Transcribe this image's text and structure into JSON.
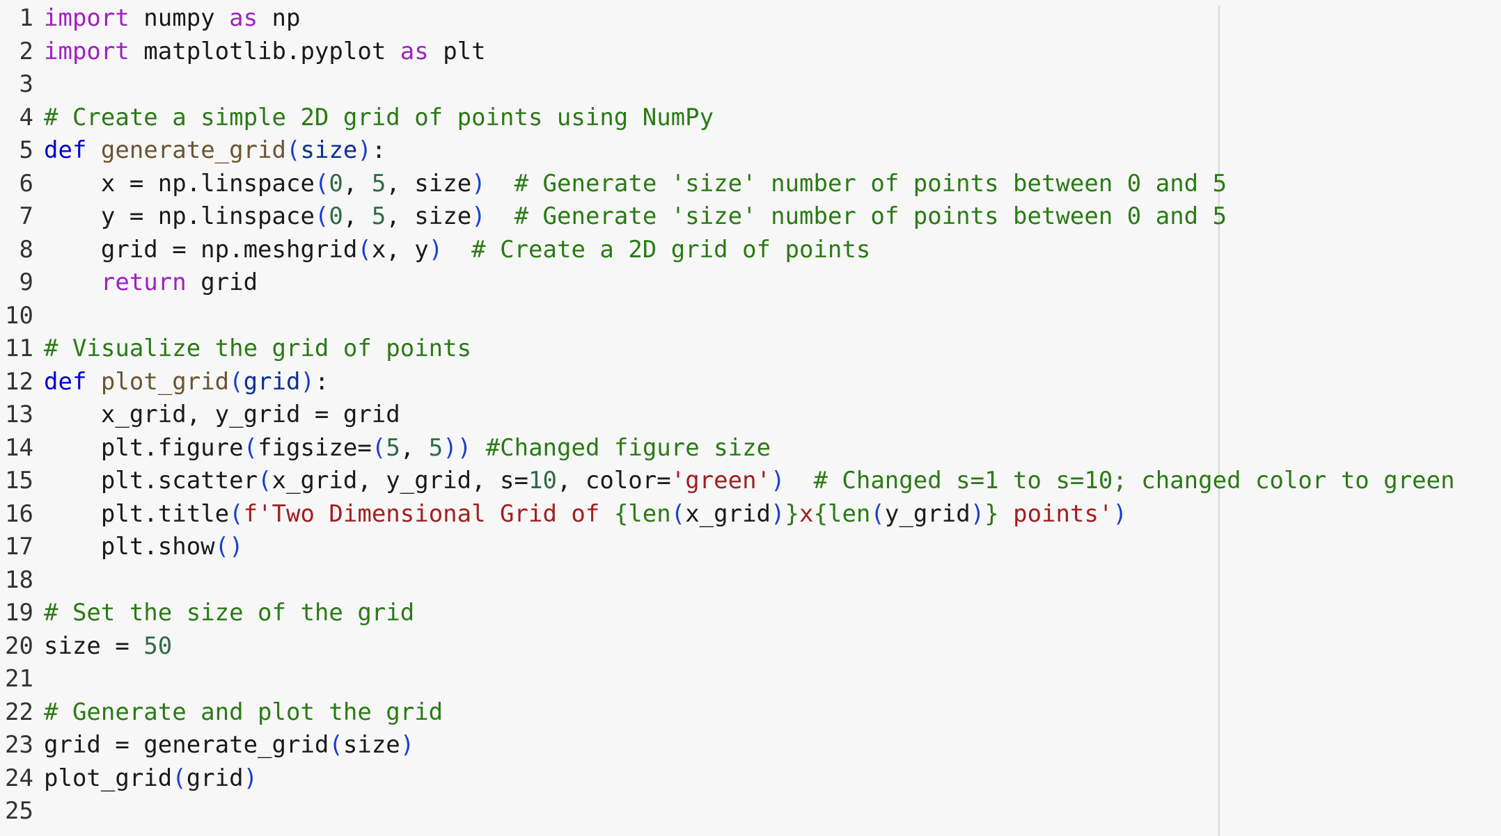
{
  "editor": {
    "lines": [
      {
        "number": "1",
        "tokens": [
          {
            "t": "import",
            "c": "kw"
          },
          {
            "t": " numpy ",
            "c": ""
          },
          {
            "t": "as",
            "c": "kw"
          },
          {
            "t": " np",
            "c": ""
          }
        ]
      },
      {
        "number": "2",
        "tokens": [
          {
            "t": "import",
            "c": "kw"
          },
          {
            "t": " matplotlib.pyplot ",
            "c": ""
          },
          {
            "t": "as",
            "c": "kw"
          },
          {
            "t": " plt",
            "c": ""
          }
        ]
      },
      {
        "number": "3",
        "tokens": []
      },
      {
        "number": "4",
        "tokens": [
          {
            "t": "# Create a simple 2D grid of points using NumPy",
            "c": "cm"
          }
        ]
      },
      {
        "number": "5",
        "tokens": [
          {
            "t": "def",
            "c": "def"
          },
          {
            "t": " ",
            "c": ""
          },
          {
            "t": "generate_grid",
            "c": "fn"
          },
          {
            "t": "(",
            "c": "paren"
          },
          {
            "t": "size",
            "c": "param"
          },
          {
            "t": ")",
            "c": "paren"
          },
          {
            "t": ":",
            "c": ""
          }
        ]
      },
      {
        "number": "6",
        "tokens": [
          {
            "t": "    x = np.linspace",
            "c": ""
          },
          {
            "t": "(",
            "c": "paren"
          },
          {
            "t": "0",
            "c": "num"
          },
          {
            "t": ", ",
            "c": ""
          },
          {
            "t": "5",
            "c": "num"
          },
          {
            "t": ", size",
            "c": ""
          },
          {
            "t": ")",
            "c": "paren"
          },
          {
            "t": "  ",
            "c": ""
          },
          {
            "t": "# Generate 'size' number of points between 0 and 5",
            "c": "cm"
          }
        ]
      },
      {
        "number": "7",
        "tokens": [
          {
            "t": "    y = np.linspace",
            "c": ""
          },
          {
            "t": "(",
            "c": "paren"
          },
          {
            "t": "0",
            "c": "num"
          },
          {
            "t": ", ",
            "c": ""
          },
          {
            "t": "5",
            "c": "num"
          },
          {
            "t": ", size",
            "c": ""
          },
          {
            "t": ")",
            "c": "paren"
          },
          {
            "t": "  ",
            "c": ""
          },
          {
            "t": "# Generate 'size' number of points between 0 and 5",
            "c": "cm"
          }
        ]
      },
      {
        "number": "8",
        "tokens": [
          {
            "t": "    grid = np.meshgrid",
            "c": ""
          },
          {
            "t": "(",
            "c": "paren"
          },
          {
            "t": "x, y",
            "c": ""
          },
          {
            "t": ")",
            "c": "paren"
          },
          {
            "t": "  ",
            "c": ""
          },
          {
            "t": "# Create a 2D grid of points",
            "c": "cm"
          }
        ]
      },
      {
        "number": "9",
        "tokens": [
          {
            "t": "    ",
            "c": ""
          },
          {
            "t": "return",
            "c": "kw"
          },
          {
            "t": " grid",
            "c": ""
          }
        ]
      },
      {
        "number": "10",
        "tokens": []
      },
      {
        "number": "11",
        "tokens": [
          {
            "t": "# Visualize the grid of points",
            "c": "cm"
          }
        ]
      },
      {
        "number": "12",
        "tokens": [
          {
            "t": "def",
            "c": "def"
          },
          {
            "t": " ",
            "c": ""
          },
          {
            "t": "plot_grid",
            "c": "fn"
          },
          {
            "t": "(",
            "c": "paren"
          },
          {
            "t": "grid",
            "c": "param"
          },
          {
            "t": ")",
            "c": "paren"
          },
          {
            "t": ":",
            "c": ""
          }
        ]
      },
      {
        "number": "13",
        "tokens": [
          {
            "t": "    x_grid, y_grid = grid",
            "c": ""
          }
        ]
      },
      {
        "number": "14",
        "tokens": [
          {
            "t": "    plt.figure",
            "c": ""
          },
          {
            "t": "(",
            "c": "paren"
          },
          {
            "t": "figsize=",
            "c": ""
          },
          {
            "t": "(",
            "c": "paren"
          },
          {
            "t": "5",
            "c": "num"
          },
          {
            "t": ", ",
            "c": ""
          },
          {
            "t": "5",
            "c": "num"
          },
          {
            "t": "))",
            "c": "paren"
          },
          {
            "t": " ",
            "c": ""
          },
          {
            "t": "#Changed figure size",
            "c": "cm"
          }
        ]
      },
      {
        "number": "15",
        "tokens": [
          {
            "t": "    plt.scatter",
            "c": ""
          },
          {
            "t": "(",
            "c": "paren"
          },
          {
            "t": "x_grid, y_grid, s=",
            "c": ""
          },
          {
            "t": "10",
            "c": "num"
          },
          {
            "t": ", color=",
            "c": ""
          },
          {
            "t": "'green'",
            "c": "str"
          },
          {
            "t": ")",
            "c": "paren"
          },
          {
            "t": "  ",
            "c": ""
          },
          {
            "t": "# Changed s=1 to s=10; changed color to green",
            "c": "cm"
          }
        ]
      },
      {
        "number": "16",
        "tokens": [
          {
            "t": "    plt.title",
            "c": ""
          },
          {
            "t": "(",
            "c": "paren"
          },
          {
            "t": "f'Two Dimensional Grid of ",
            "c": "str"
          },
          {
            "t": "{",
            "c": "brace"
          },
          {
            "t": "len",
            "c": "brace"
          },
          {
            "t": "(",
            "c": "paren"
          },
          {
            "t": "x_grid",
            "c": ""
          },
          {
            "t": ")",
            "c": "paren"
          },
          {
            "t": "}",
            "c": "brace"
          },
          {
            "t": "x",
            "c": "str"
          },
          {
            "t": "{",
            "c": "brace"
          },
          {
            "t": "len",
            "c": "brace"
          },
          {
            "t": "(",
            "c": "paren"
          },
          {
            "t": "y_grid",
            "c": ""
          },
          {
            "t": ")",
            "c": "paren"
          },
          {
            "t": "}",
            "c": "brace"
          },
          {
            "t": " points'",
            "c": "str"
          },
          {
            "t": ")",
            "c": "paren"
          }
        ]
      },
      {
        "number": "17",
        "tokens": [
          {
            "t": "    plt.show",
            "c": ""
          },
          {
            "t": "()",
            "c": "paren"
          }
        ]
      },
      {
        "number": "18",
        "tokens": []
      },
      {
        "number": "19",
        "tokens": [
          {
            "t": "# Set the size of the grid",
            "c": "cm"
          }
        ]
      },
      {
        "number": "20",
        "tokens": [
          {
            "t": "size = ",
            "c": ""
          },
          {
            "t": "50",
            "c": "num"
          }
        ]
      },
      {
        "number": "21",
        "tokens": []
      },
      {
        "number": "22",
        "tokens": [
          {
            "t": "# Generate and plot the grid",
            "c": "cm"
          }
        ]
      },
      {
        "number": "23",
        "tokens": [
          {
            "t": "grid = generate_grid",
            "c": ""
          },
          {
            "t": "(",
            "c": "paren"
          },
          {
            "t": "size",
            "c": ""
          },
          {
            "t": ")",
            "c": "paren"
          }
        ]
      },
      {
        "number": "24",
        "tokens": [
          {
            "t": "plot_grid",
            "c": ""
          },
          {
            "t": "(",
            "c": "paren"
          },
          {
            "t": "grid",
            "c": ""
          },
          {
            "t": ")",
            "c": "paren"
          }
        ]
      },
      {
        "number": "25",
        "tokens": []
      }
    ],
    "colors": {
      "background": "#f7f7f7",
      "keyword": "#a020c0",
      "def_keyword": "#0000d0",
      "function_name": "#6b5530",
      "comment": "#2a7a14",
      "number": "#2f6a44",
      "string": "#a11f1f",
      "parenthesis": "#1a3fd0",
      "parameter": "#0b2f8f"
    }
  }
}
